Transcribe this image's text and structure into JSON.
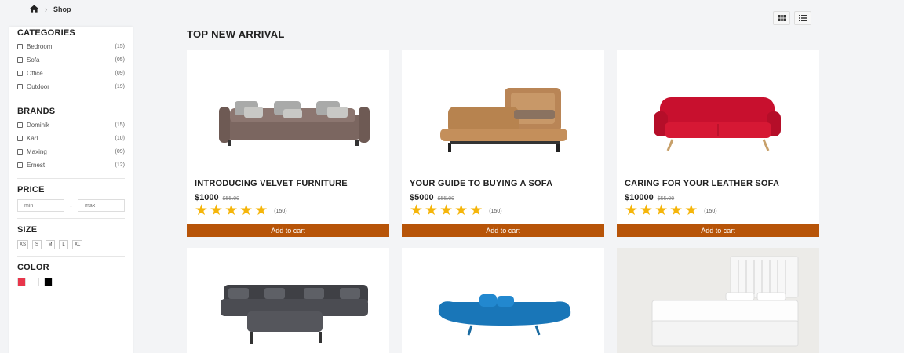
{
  "breadcrumb": {
    "current": "Shop",
    "home_icon": "home-icon",
    "separator_icon": "chevron-right-icon"
  },
  "sidebar": {
    "categories": {
      "title": "CATEGORIES",
      "items": [
        {
          "label": "Bedroom",
          "count": "(15)"
        },
        {
          "label": "Sofa",
          "count": "(05)"
        },
        {
          "label": "Office",
          "count": "(09)"
        },
        {
          "label": "Outdoor",
          "count": "(19)"
        }
      ]
    },
    "brands": {
      "title": "BRANDS",
      "items": [
        {
          "label": "Dominik",
          "count": "(15)"
        },
        {
          "label": "Karl",
          "count": "(10)"
        },
        {
          "label": "Maxing",
          "count": "(09)"
        },
        {
          "label": "Ernest",
          "count": "(12)"
        }
      ]
    },
    "price": {
      "title": "PRICE",
      "min_placeholder": "min",
      "max_placeholder": "max",
      "separator": "-"
    },
    "size": {
      "title": "SIZE",
      "options": [
        "XS",
        "S",
        "M",
        "L",
        "XL"
      ]
    },
    "color": {
      "title": "COLOR",
      "swatches": [
        "#e8364b",
        "#ffffff",
        "#000000"
      ]
    }
  },
  "view_toggle": {
    "grid_icon": "grid-icon",
    "list_icon": "list-icon"
  },
  "main": {
    "title": "TOP NEW ARRIVAL",
    "products": [
      {
        "name": "INTRODUCING VELVET FURNITURE",
        "price": "$1000",
        "old_price": "$55.00",
        "rating": 5,
        "reviews": "(150)",
        "cta": "Add to cart",
        "image": "brown-velvet-sofa"
      },
      {
        "name": "YOUR GUIDE TO BUYING A SOFA",
        "price": "$5000",
        "old_price": "$55.00",
        "rating": 5,
        "reviews": "(150)",
        "cta": "Add to cart",
        "image": "tan-reclining-sofa"
      },
      {
        "name": "CARING FOR YOUR LEATHER SOFA",
        "price": "$10000",
        "old_price": "$55.00",
        "rating": 5,
        "reviews": "(150)",
        "cta": "Add to cart",
        "image": "red-tufted-sofa"
      },
      {
        "image": "gray-sectional-sofa"
      },
      {
        "image": "blue-curved-sofa"
      },
      {
        "image": "white-bed"
      }
    ]
  },
  "colors": {
    "accent": "#b75408",
    "star": "#f5b50a",
    "background": "#f3f4f6"
  }
}
